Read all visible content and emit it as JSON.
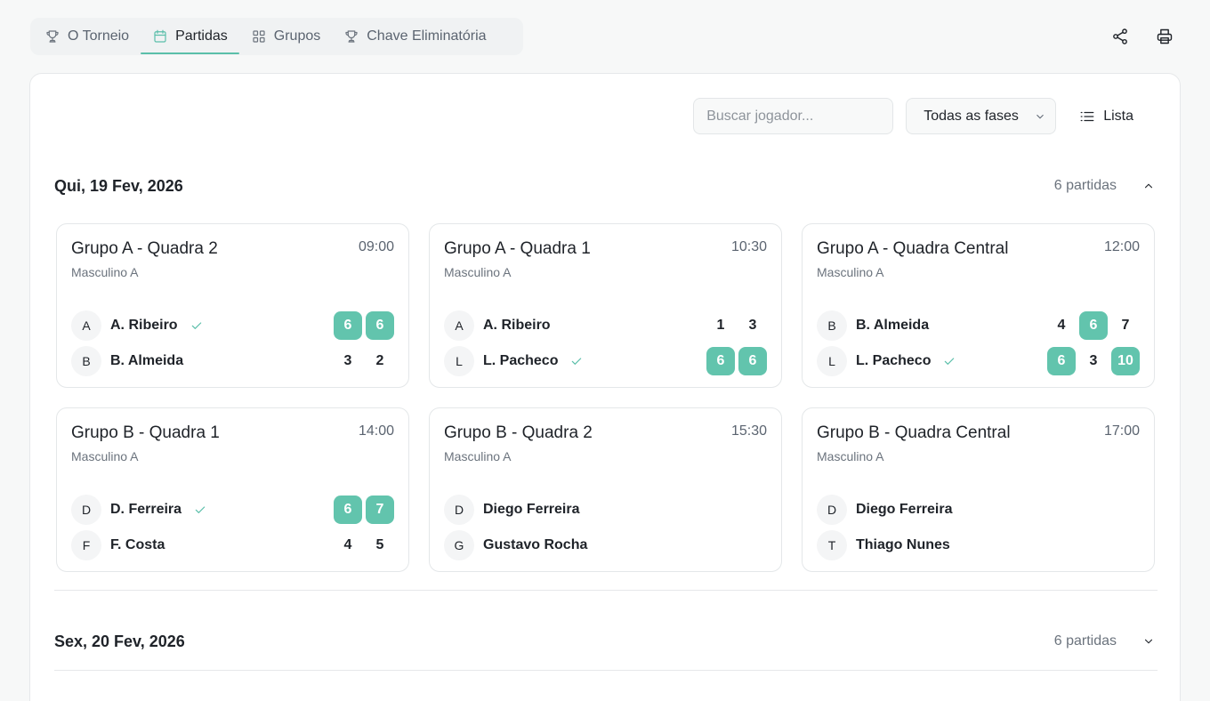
{
  "tabs": [
    {
      "label": "O Torneio",
      "icon": "trophy-icon",
      "active": false
    },
    {
      "label": "Partidas",
      "icon": "calendar-icon",
      "active": true
    },
    {
      "label": "Grupos",
      "icon": "grid-icon",
      "active": false
    },
    {
      "label": "Chave Eliminatória",
      "icon": "trophy-icon",
      "active": false
    }
  ],
  "actions": {
    "share_icon": "share-icon",
    "print_icon": "printer-icon"
  },
  "filters": {
    "search_placeholder": "Buscar jogador...",
    "phase_selected": "Todas as fases",
    "view_label": "Lista"
  },
  "accent_color": "#62c4ad",
  "days": [
    {
      "title": "Qui, 19 Fev, 2026",
      "count": "6 partidas",
      "expanded": true,
      "matches": [
        {
          "title": "Grupo A - Quadra 2",
          "category": "Masculino A",
          "time": "09:00",
          "players": [
            {
              "initial": "A",
              "name": "A. Ribeiro",
              "winner": true,
              "scores": [
                {
                  "v": "6",
                  "win": true
                },
                {
                  "v": "6",
                  "win": true
                }
              ]
            },
            {
              "initial": "B",
              "name": "B. Almeida",
              "winner": false,
              "scores": [
                {
                  "v": "3",
                  "win": false
                },
                {
                  "v": "2",
                  "win": false
                }
              ]
            }
          ]
        },
        {
          "title": "Grupo A - Quadra 1",
          "category": "Masculino A",
          "time": "10:30",
          "players": [
            {
              "initial": "A",
              "name": "A. Ribeiro",
              "winner": false,
              "scores": [
                {
                  "v": "1",
                  "win": false
                },
                {
                  "v": "3",
                  "win": false
                }
              ]
            },
            {
              "initial": "L",
              "name": "L. Pacheco",
              "winner": true,
              "scores": [
                {
                  "v": "6",
                  "win": true
                },
                {
                  "v": "6",
                  "win": true
                }
              ]
            }
          ]
        },
        {
          "title": "Grupo A - Quadra Central",
          "category": "Masculino A",
          "time": "12:00",
          "players": [
            {
              "initial": "B",
              "name": "B. Almeida",
              "winner": false,
              "scores": [
                {
                  "v": "4",
                  "win": false
                },
                {
                  "v": "6",
                  "win": true
                },
                {
                  "v": "7",
                  "win": false
                }
              ]
            },
            {
              "initial": "L",
              "name": "L. Pacheco",
              "winner": true,
              "scores": [
                {
                  "v": "6",
                  "win": true
                },
                {
                  "v": "3",
                  "win": false
                },
                {
                  "v": "10",
                  "win": true
                }
              ]
            }
          ]
        },
        {
          "title": "Grupo B - Quadra 1",
          "category": "Masculino A",
          "time": "14:00",
          "players": [
            {
              "initial": "D",
              "name": "D. Ferreira",
              "winner": true,
              "scores": [
                {
                  "v": "6",
                  "win": true
                },
                {
                  "v": "7",
                  "win": true
                }
              ]
            },
            {
              "initial": "F",
              "name": "F. Costa",
              "winner": false,
              "scores": [
                {
                  "v": "4",
                  "win": false
                },
                {
                  "v": "5",
                  "win": false
                }
              ]
            }
          ]
        },
        {
          "title": "Grupo B - Quadra 2",
          "category": "Masculino A",
          "time": "15:30",
          "players": [
            {
              "initial": "D",
              "name": "Diego Ferreira",
              "winner": false,
              "scores": []
            },
            {
              "initial": "G",
              "name": "Gustavo Rocha",
              "winner": false,
              "scores": []
            }
          ]
        },
        {
          "title": "Grupo B - Quadra Central",
          "category": "Masculino A",
          "time": "17:00",
          "players": [
            {
              "initial": "D",
              "name": "Diego Ferreira",
              "winner": false,
              "scores": []
            },
            {
              "initial": "T",
              "name": "Thiago Nunes",
              "winner": false,
              "scores": []
            }
          ]
        }
      ]
    },
    {
      "title": "Sex, 20 Fev, 2026",
      "count": "6 partidas",
      "expanded": false,
      "matches": []
    }
  ]
}
